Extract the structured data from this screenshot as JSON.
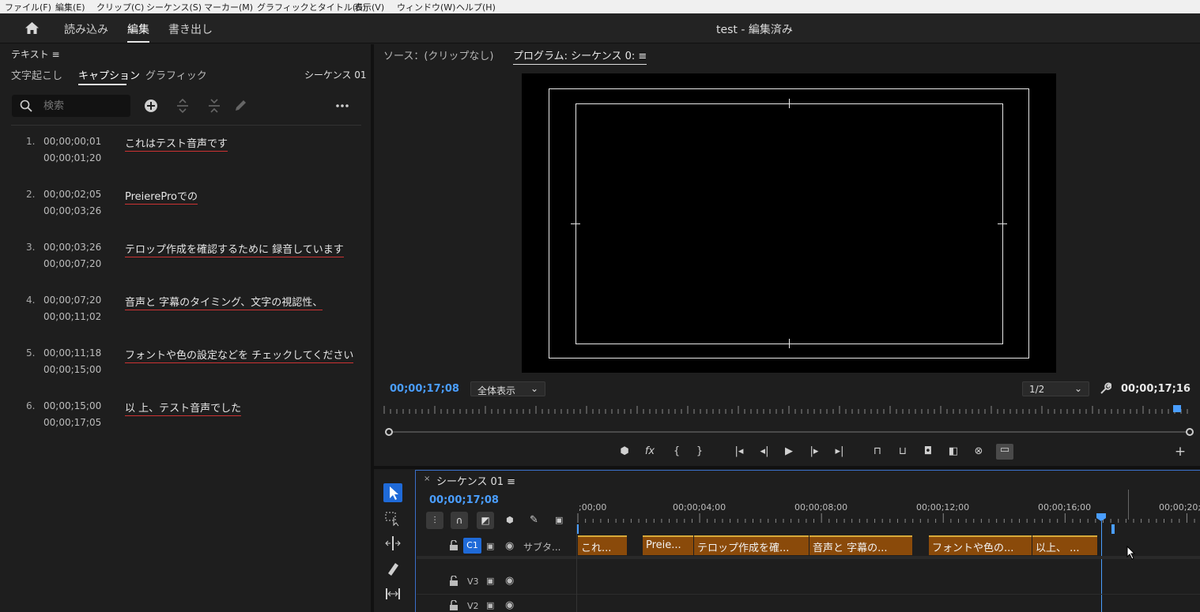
{
  "menu": [
    "ファイル(F)",
    "編集(E)",
    "クリップ(C)",
    "シーケンス(S)",
    "マーカー(M)",
    "グラフィックとタイトル(G)",
    "表示(V)",
    "ウィンドウ(W)",
    "ヘルプ(H)"
  ],
  "workspace": {
    "import": "読み込み",
    "edit": "編集",
    "export": "書き出し"
  },
  "doc_title": "test - 編集済み",
  "text_panel": {
    "title": "テキスト ≡",
    "tabs": [
      "文字起こし",
      "キャプション",
      "グラフィック"
    ],
    "sequence": "シーケンス 01",
    "search_placeholder": "検索"
  },
  "captions": [
    {
      "num": "1.",
      "in": "00;00;00;01",
      "out": "00;00;01;20",
      "text": "これはテスト音声です"
    },
    {
      "num": "2.",
      "in": "00;00;02;05",
      "out": "00;00;03;26",
      "text": "PreiereProでの"
    },
    {
      "num": "3.",
      "in": "00;00;03;26",
      "out": "00;00;07;20",
      "text": "テロップ作成を確認するために 録音しています"
    },
    {
      "num": "4.",
      "in": "00;00;07;20",
      "out": "00;00;11;02",
      "text": "音声と 字幕のタイミング、文字の視認性、"
    },
    {
      "num": "5.",
      "in": "00;00;11;18",
      "out": "00;00;15;00",
      "text": "フォントや色の設定などを チェックしてください"
    },
    {
      "num": "6.",
      "in": "00;00;15;00",
      "out": "00;00;17;05",
      "text": "以 上、テスト音声でした"
    }
  ],
  "monitor": {
    "source_tab": "ソース：(クリップなし)",
    "program_tab": "プログラム: シーケンス 0: ≡",
    "timecode": "00;00;17;08",
    "zoom": "全体表示",
    "resolution": "1/2",
    "duration": "00;00;17;16"
  },
  "timeline": {
    "title": "シーケンス 01 ≡",
    "timecode": "00;00;17;08",
    "ruler": [
      ";00;00",
      "00;00;04;00",
      "00;00;08;00",
      "00;00;12;00",
      "00;00;16;00",
      "00;00;20;"
    ],
    "tracks": [
      {
        "id": "C1",
        "name": "サブタ..."
      },
      {
        "id": "V3",
        "name": ""
      },
      {
        "id": "V2",
        "name": ""
      }
    ],
    "clips": [
      "これ...",
      "Preie...",
      "テロップ作成を確...",
      "音声と 字幕の...",
      "フォントや色の...",
      "以上、 ..."
    ]
  }
}
